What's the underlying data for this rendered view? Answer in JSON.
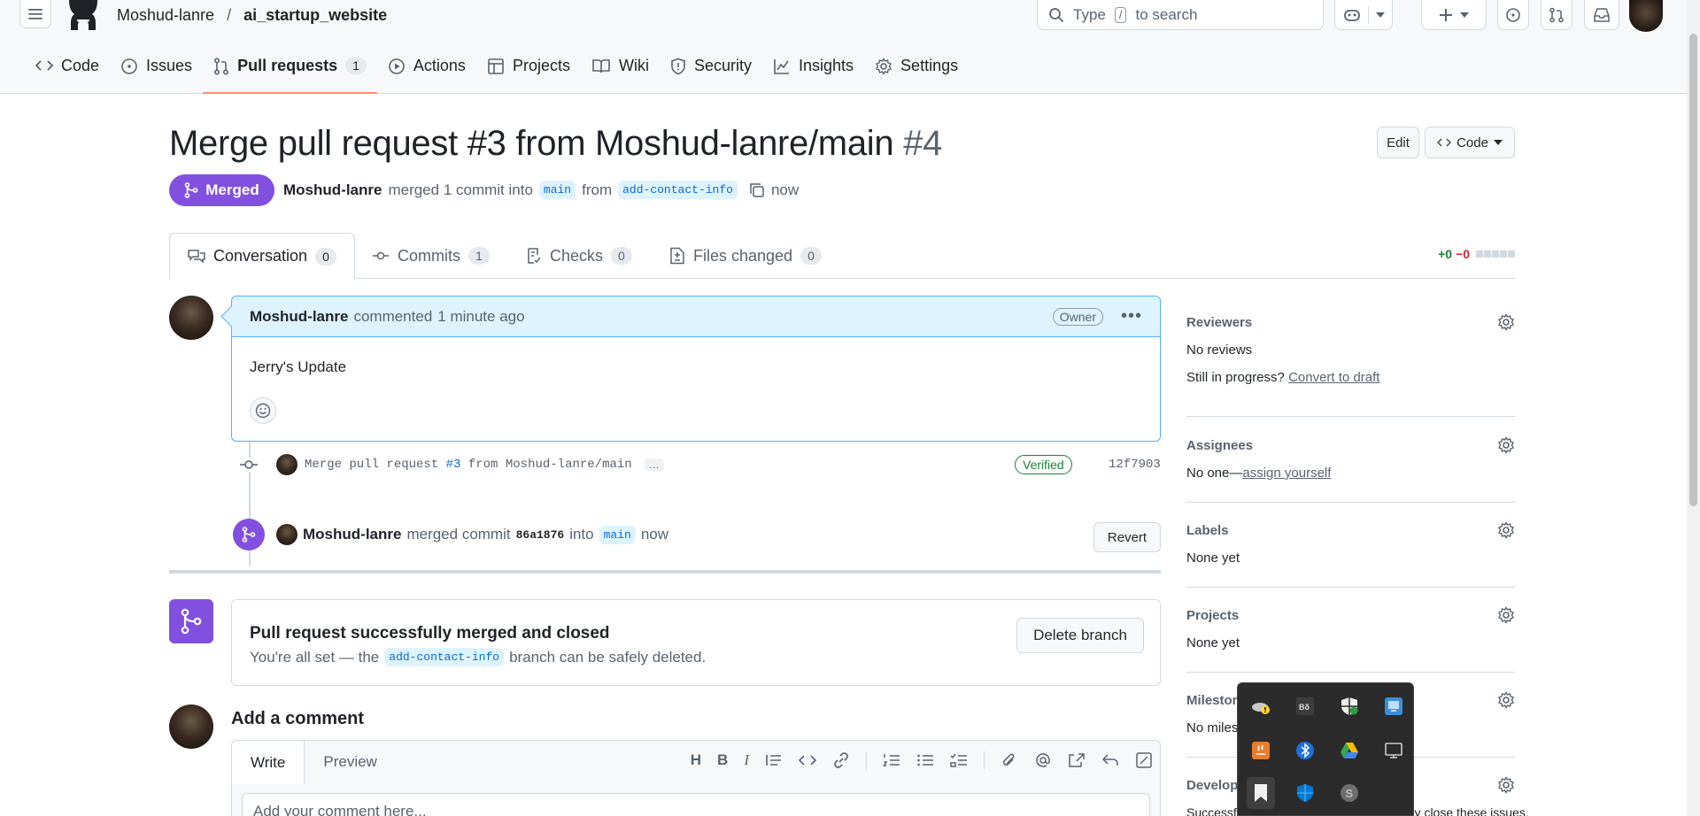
{
  "header": {
    "owner": "Moshud-lanre",
    "separator": "/",
    "repo": "ai_startup_website",
    "search_prefix": "Type",
    "search_key": "/",
    "search_suffix": "to search"
  },
  "repo_nav": [
    {
      "label": "Code",
      "icon": "code-icon"
    },
    {
      "label": "Issues",
      "icon": "issue-opened-icon"
    },
    {
      "label": "Pull requests",
      "icon": "git-pull-request-icon",
      "count": "1"
    },
    {
      "label": "Actions",
      "icon": "play-icon"
    },
    {
      "label": "Projects",
      "icon": "table-icon"
    },
    {
      "label": "Wiki",
      "icon": "book-icon"
    },
    {
      "label": "Security",
      "icon": "shield-icon"
    },
    {
      "label": "Insights",
      "icon": "graph-icon"
    },
    {
      "label": "Settings",
      "icon": "gear-icon"
    }
  ],
  "pr": {
    "title": "Merge pull request #3 from Moshud-lanre/main",
    "number": "#4",
    "edit_label": "Edit",
    "code_label": "Code",
    "state": "Merged",
    "author": "Moshud-lanre",
    "meta_merged": "merged 1 commit into",
    "base_branch": "main",
    "meta_from": "from",
    "head_branch": "add-contact-info",
    "meta_time": "now"
  },
  "tabs": [
    {
      "label": "Conversation",
      "count": "0",
      "icon": "comment-discussion-icon"
    },
    {
      "label": "Commits",
      "count": "1",
      "icon": "git-commit-icon"
    },
    {
      "label": "Checks",
      "count": "0",
      "icon": "checklist-icon"
    },
    {
      "label": "Files changed",
      "count": "0",
      "icon": "file-diff-icon"
    }
  ],
  "diffstat": {
    "additions": "+0",
    "deletions": "−0"
  },
  "comment": {
    "author": "Moshud-lanre",
    "action": "commented",
    "time": "1 minute ago",
    "role": "Owner",
    "body": "Jerry's Update"
  },
  "commit": {
    "message_prefix": "Merge pull request ",
    "message_link": "#3",
    "message_suffix": " from Moshud-lanre/main",
    "ellipsis": "…",
    "verified": "Verified",
    "sha": "12f7903"
  },
  "merge_event": {
    "author": "Moshud-lanre",
    "text1": "merged commit",
    "sha": "86a1876",
    "text2": "into",
    "branch": "main",
    "time": "now",
    "revert_label": "Revert"
  },
  "merged_box": {
    "title": "Pull request successfully merged and closed",
    "text1": "You're all set — the",
    "branch": "add-contact-info",
    "text2": "branch can be safely deleted.",
    "delete_label": "Delete branch"
  },
  "add_comment": {
    "title": "Add a comment",
    "write_tab": "Write",
    "preview_tab": "Preview",
    "placeholder": "Add your comment here..."
  },
  "sidebar": {
    "reviewers": {
      "title": "Reviewers",
      "value": "No reviews",
      "progress_text": "Still in progress?",
      "progress_link": "Convert to draft"
    },
    "assignees": {
      "title": "Assignees",
      "value": "No one—",
      "link": "assign yourself"
    },
    "labels": {
      "title": "Labels",
      "value": "None yet"
    },
    "projects": {
      "title": "Projects",
      "value": "None yet"
    },
    "milestone": {
      "title": "Milestone",
      "value": "No milestone"
    },
    "development": {
      "title": "Development",
      "value": "Successfully merging this pull request may close these issues."
    }
  },
  "tray_icons": [
    "onedrive-warning-icon",
    "screen-app-icon",
    "defender-icon",
    "network-app-icon",
    "java-icon",
    "bluetooth-icon",
    "google-drive-icon",
    "display-icon",
    "bookmark-app-icon",
    "defender-shield-icon",
    "skype-icon"
  ],
  "colors": {
    "merged": "#8250df",
    "accent": "#0969da",
    "nav_underline": "#fd8c73",
    "success": "#1a7f37",
    "danger": "#d1242f"
  }
}
